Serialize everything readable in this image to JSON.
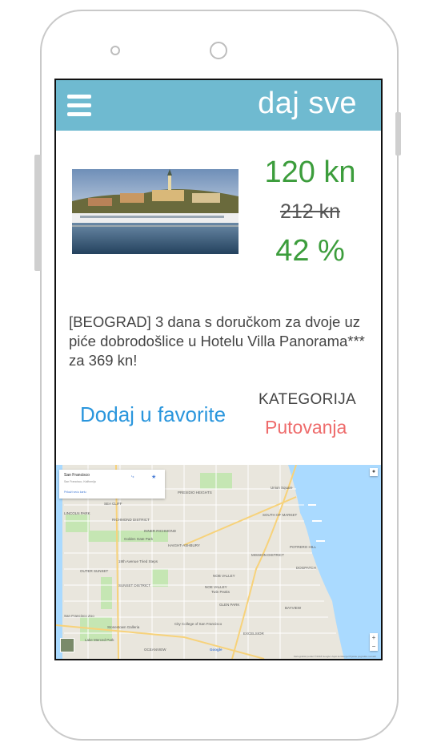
{
  "app": {
    "brand": "daj sve"
  },
  "deal": {
    "price_new": "120 kn",
    "price_old": "212 kn",
    "discount": "42 %",
    "description": "[BEOGRAD] 3 dana s doručkom za dvoje uz piće dobrodošlice u Hotelu Villa Panorama*** za 369 kn!",
    "favorite_label": "Dodaj u favorite",
    "category_label": "KATEGORIJA",
    "category_value": "Putovanja"
  },
  "map": {
    "card_title": "San Francisco",
    "card_subtitle": "San Francisco, Kalifornija",
    "card_link": "Prikaži veću kartu",
    "directions": "Upute",
    "save": "Spremi",
    "labels": [
      "LINCOLN PARK",
      "RICHMOND DISTRICT",
      "INNER RICHMOND",
      "SEA CLIFF",
      "Golden Gate Park",
      "HAIGHT-ASHBURY",
      "SUNSET DISTRICT",
      "OUTER SUNSET",
      "19th Avenue Tried Steps",
      "NOB VALLEY",
      "Twin Peaks",
      "MISSION DISTRICT",
      "SOUTH OF MARKET",
      "POTRERO HILL",
      "BAYVIEW",
      "GLEN PARK",
      "EXCELSIOR",
      "City College of San Francisco",
      "Stonestown Galleria",
      "Lake Merced Park",
      "San Francisco Zoo",
      "DOGPATCH",
      "Union Square",
      "PRESIDIO HEIGHTS",
      "NOE VALLEY",
      "OCEANVIEW",
      "Google"
    ],
    "footer": "Kartografski podaci ©2018 Google  Uvjeti korištenja  Prijavite pogrešku na karti"
  },
  "colors": {
    "header": "#6fbad0",
    "price": "#3c9d3c",
    "favorite": "#2a96dd",
    "category": "#ee6b6b"
  }
}
